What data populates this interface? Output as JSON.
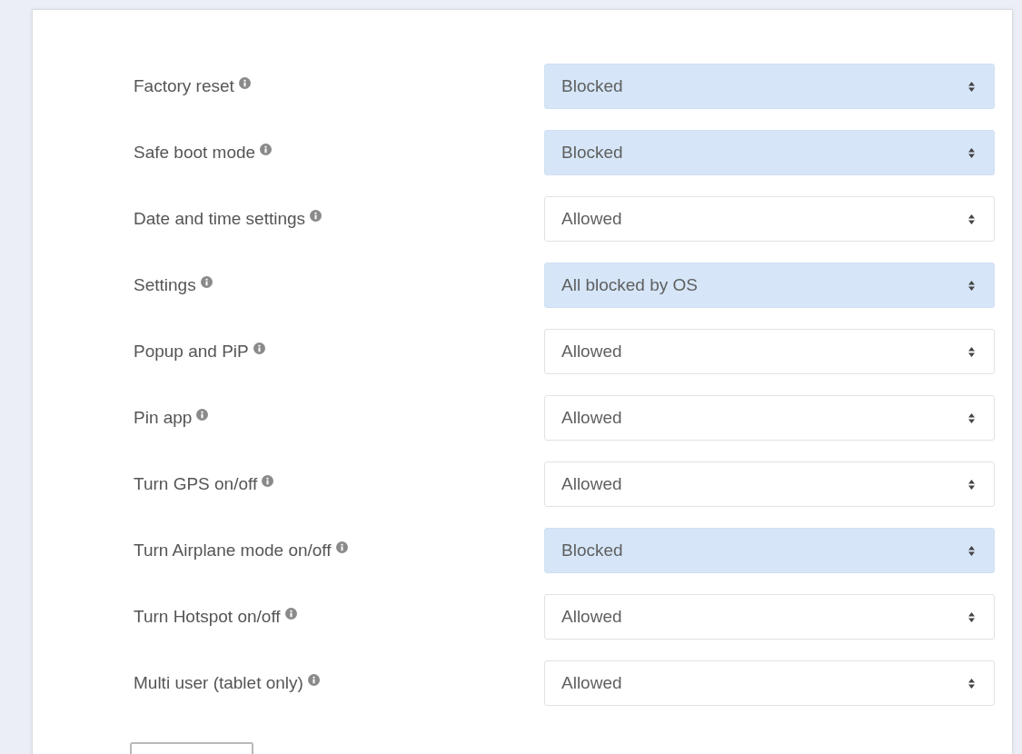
{
  "settings": [
    {
      "label": "Factory reset",
      "value": "Blocked",
      "highlighted": true
    },
    {
      "label": "Safe boot mode",
      "value": "Blocked",
      "highlighted": true
    },
    {
      "label": "Date and time settings",
      "value": "Allowed",
      "highlighted": false
    },
    {
      "label": "Settings",
      "value": "All blocked by OS",
      "highlighted": true
    },
    {
      "label": "Popup and PiP",
      "value": "Allowed",
      "highlighted": false
    },
    {
      "label": "Pin app",
      "value": "Allowed",
      "highlighted": false
    },
    {
      "label": "Turn GPS on/off",
      "value": "Allowed",
      "highlighted": false
    },
    {
      "label": "Turn Airplane mode on/off",
      "value": "Blocked",
      "highlighted": true
    },
    {
      "label": "Turn Hotspot on/off",
      "value": "Allowed",
      "highlighted": false
    },
    {
      "label": "Multi user (tablet only)",
      "value": "Allowed",
      "highlighted": false
    }
  ]
}
